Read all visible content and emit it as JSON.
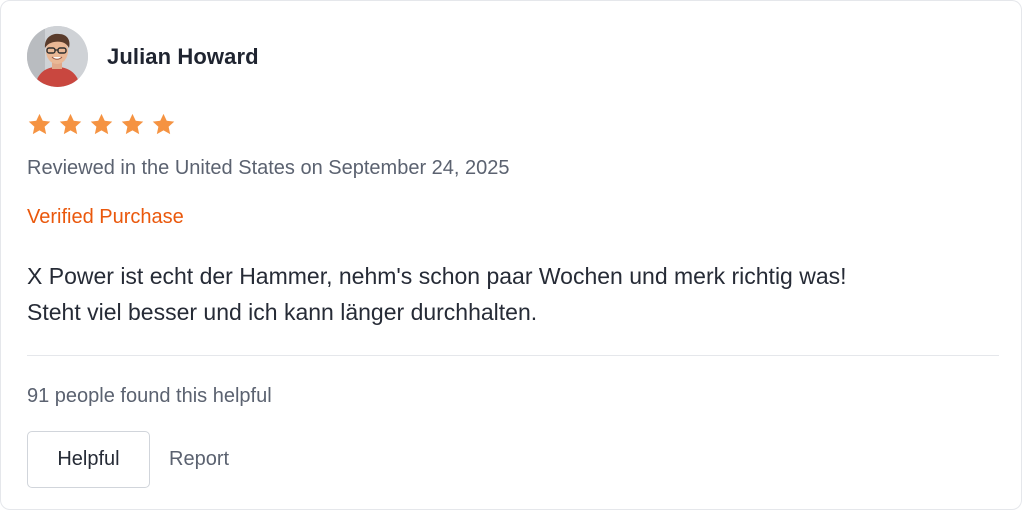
{
  "review": {
    "author": "Julian Howard",
    "avatar_icon": "user-avatar-photo",
    "rating": 5,
    "rating_max": 5,
    "star_color": "#f59342",
    "meta": "Reviewed in the United States on September 24, 2025",
    "verified_label": "Verified Purchase",
    "verified_color": "#ea580c",
    "text_line1": "X Power ist echt der Hammer, nehm's schon paar Wochen und merk richtig was!",
    "text_line2": "Steht viel besser und ich kann länger durchhalten.",
    "helpful_count_text": "91 people found this helpful"
  },
  "actions": {
    "helpful_label": "Helpful",
    "report_label": "Report"
  }
}
